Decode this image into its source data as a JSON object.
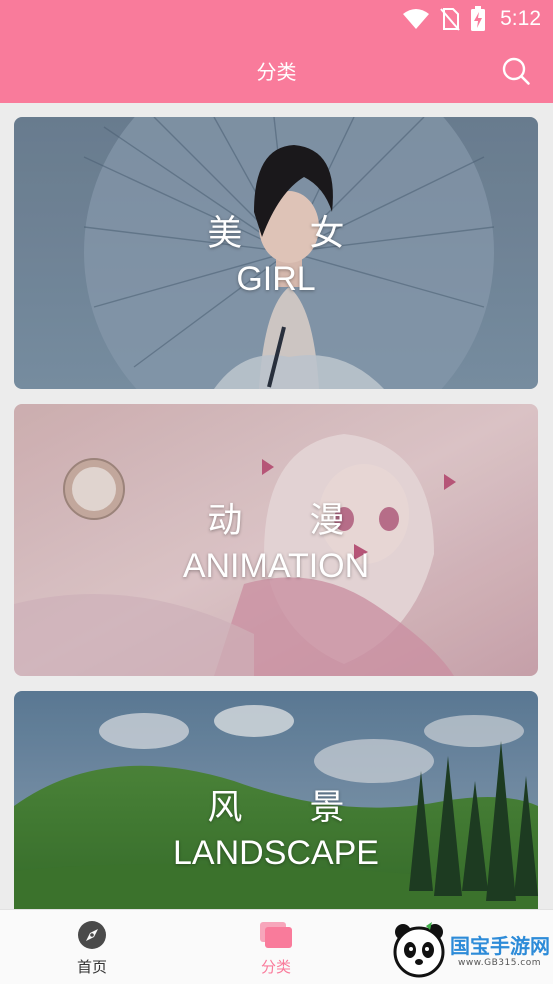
{
  "status_bar": {
    "time": "5:12"
  },
  "app_bar": {
    "title": "分类"
  },
  "categories": [
    {
      "cn": "美 女",
      "en": "GIRL"
    },
    {
      "cn": "动 漫",
      "en": "ANIMATION"
    },
    {
      "cn": "风 景",
      "en": "LANDSCAPE"
    }
  ],
  "bottom_nav": {
    "items": [
      {
        "label": "首页",
        "icon": "compass-icon",
        "active": false
      },
      {
        "label": "分类",
        "icon": "cards-icon",
        "active": true
      }
    ]
  },
  "watermark": {
    "text": "国宝手游网",
    "sub": "www.GB315.com"
  },
  "colors": {
    "accent": "#f97b9b",
    "nav_active": "#f97b9b",
    "nav_inactive": "#333333"
  }
}
